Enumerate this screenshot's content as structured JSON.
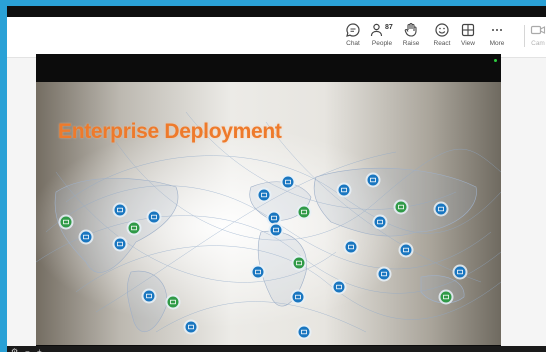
{
  "toolbar": {
    "buttons": [
      {
        "key": "chat",
        "label": "Chat",
        "icon": "chat-icon"
      },
      {
        "key": "people",
        "label": "People",
        "icon": "people-icon",
        "count": "87"
      },
      {
        "key": "raise",
        "label": "Raise",
        "icon": "raise-hand-icon"
      },
      {
        "key": "react",
        "label": "React",
        "icon": "react-icon"
      },
      {
        "key": "view",
        "label": "View",
        "icon": "view-icon"
      },
      {
        "key": "more",
        "label": "More",
        "icon": "more-icon"
      },
      {
        "key": "camera",
        "label": "Cam",
        "icon": "camera-icon"
      }
    ]
  },
  "slide": {
    "title": "Enterprise Deployment",
    "node_colors": {
      "blue": "#1976c0",
      "green": "#2f9a47",
      "ring": "#e8f1f8"
    }
  },
  "colors": {
    "frame_border": "#2aa1d6",
    "title": "#ee7a2b"
  }
}
